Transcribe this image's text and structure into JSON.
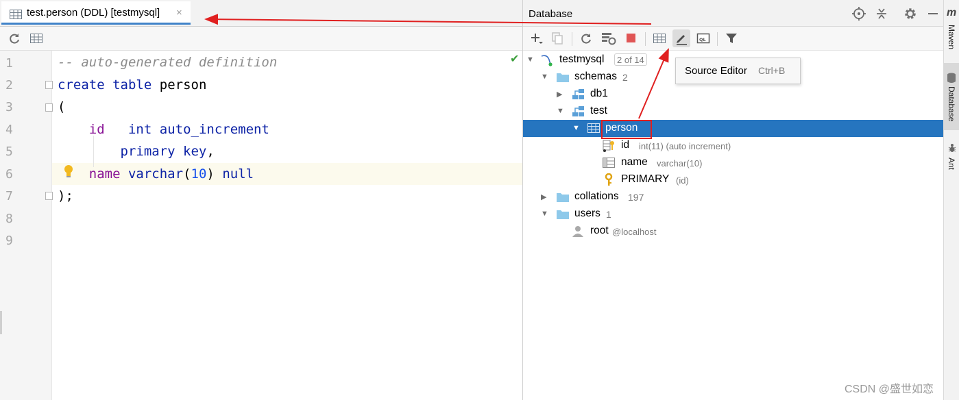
{
  "editor": {
    "tab": {
      "label": "test.person (DDL) [testmysql]",
      "close_glyph": "×"
    },
    "toolbar": {
      "icons": [
        "refresh-icon",
        "table-view-icon"
      ]
    },
    "line_numbers": [
      "1",
      "2",
      "3",
      "4",
      "5",
      "6",
      "7",
      "8",
      "9"
    ],
    "code": {
      "l1": "-- auto-generated definition",
      "l2_kw1": "create",
      "l2_kw2": "table",
      "l2_name": "person",
      "l3": "(",
      "l4_field": "id",
      "l4_type": "int",
      "l4_rest": "auto_increment",
      "l5_kw1": "primary",
      "l5_kw2": "key",
      "l5_punct": ",",
      "l6_field": "name",
      "l6_type": "varchar",
      "l6_open": "(",
      "l6_num": "10",
      "l6_close": ")",
      "l6_null": "null",
      "l7": ");"
    }
  },
  "database": {
    "title": "Database",
    "header_icons": [
      "locate-icon",
      "collapse-icon",
      "gear-icon",
      "minimize-icon"
    ],
    "toolbar_icons": [
      "add-icon",
      "duplicate-icon",
      "refresh-icon",
      "sync-schema-icon",
      "stop-icon",
      "table-icon",
      "edit-source-icon",
      "console-icon",
      "filter-icon"
    ],
    "tree": {
      "conn": {
        "name": "testmysql",
        "badge": "2 of 14"
      },
      "schemas": {
        "label": "schemas",
        "count": "2"
      },
      "db1": "db1",
      "test": "test",
      "person": "person",
      "col_id": {
        "name": "id",
        "meta": "int(11) (auto increment)"
      },
      "col_name": {
        "name": "name",
        "meta": "varchar(10)"
      },
      "pk": {
        "name": "PRIMARY",
        "meta": "(id)"
      },
      "collations": {
        "label": "collations",
        "count": "197"
      },
      "users": {
        "label": "users",
        "count": "1"
      },
      "root": {
        "name": "root",
        "host": "@localhost"
      }
    },
    "tooltip": {
      "label": "Source Editor",
      "shortcut": "Ctrl+B"
    }
  },
  "right_stripe": {
    "m": "m",
    "maven": "Maven",
    "database": "Database",
    "ant": "Ant"
  },
  "watermark": "CSDN @盛世如恋",
  "colors": {
    "selection": "#2675bf",
    "annotation": "#e02020",
    "keyword": "#0d23a6",
    "field": "#871094",
    "tab_underline": "#4083c9"
  }
}
